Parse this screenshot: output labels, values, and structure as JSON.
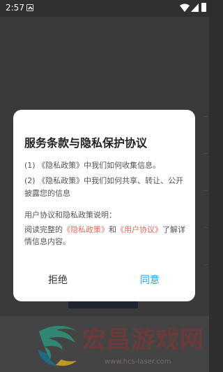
{
  "status_bar": {
    "time": "2:57",
    "icons": [
      "notification-icon",
      "wifi-icon",
      "signal-icon",
      "battery-icon"
    ]
  },
  "dialog": {
    "title": "服务条款与隐私保护协议",
    "items": [
      "(1) 《隐私政策》中我们如何收集信息。",
      "(2) 《隐私政策》中我们如何共享、转让、公开披露您的信息"
    ],
    "description_label": "用户协议和隐私政策说明：",
    "description": {
      "prefix": "阅读完整的",
      "privacy_link": "《隐私政策》",
      "and": "和",
      "user_link": "《用户协议》",
      "suffix": "了解详情信息内容。"
    },
    "reject_label": "拒绝",
    "agree_label": "同意"
  },
  "banner": {
    "brand": "宏昌游戏网",
    "url": "www.hcs-laser.com"
  },
  "colors": {
    "link": "#e46a5a",
    "agree": "#2aa0e0",
    "dialog_bg": "#ffffff",
    "overlay": "#2f2f2f"
  }
}
